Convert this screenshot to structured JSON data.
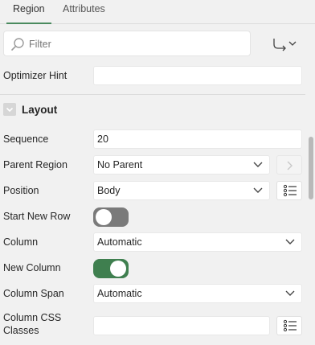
{
  "tabs": [
    {
      "label": "Region",
      "active": true
    },
    {
      "label": "Attributes",
      "active": false
    }
  ],
  "toolbar": {
    "filter_placeholder": "Filter",
    "icons": {
      "search": "search-icon",
      "goto": "goto-group-icon"
    }
  },
  "properties": {
    "optimizer_hint": {
      "label": "Optimizer Hint",
      "value": ""
    },
    "layout_section": {
      "title": "Layout",
      "collapse_icon": "chevron-down-icon"
    },
    "sequence": {
      "label": "Sequence",
      "value": "20"
    },
    "parent_region": {
      "label": "Parent Region",
      "value": "No Parent"
    },
    "position": {
      "label": "Position",
      "value": "Body"
    },
    "start_new_row": {
      "label": "Start New Row",
      "state": "off"
    },
    "column": {
      "label": "Column",
      "value": "Automatic"
    },
    "new_column": {
      "label": "New Column",
      "state": "on"
    },
    "column_span": {
      "label": "Column Span",
      "value": "Automatic"
    },
    "column_css_classes": {
      "label": "Column CSS Classes",
      "value": ""
    }
  },
  "colors": {
    "accent": "#4a8a5e",
    "toggle_on": "#3f7f4f",
    "toggle_off": "#7a7a7a",
    "panel_bg": "#f1f1f1"
  }
}
